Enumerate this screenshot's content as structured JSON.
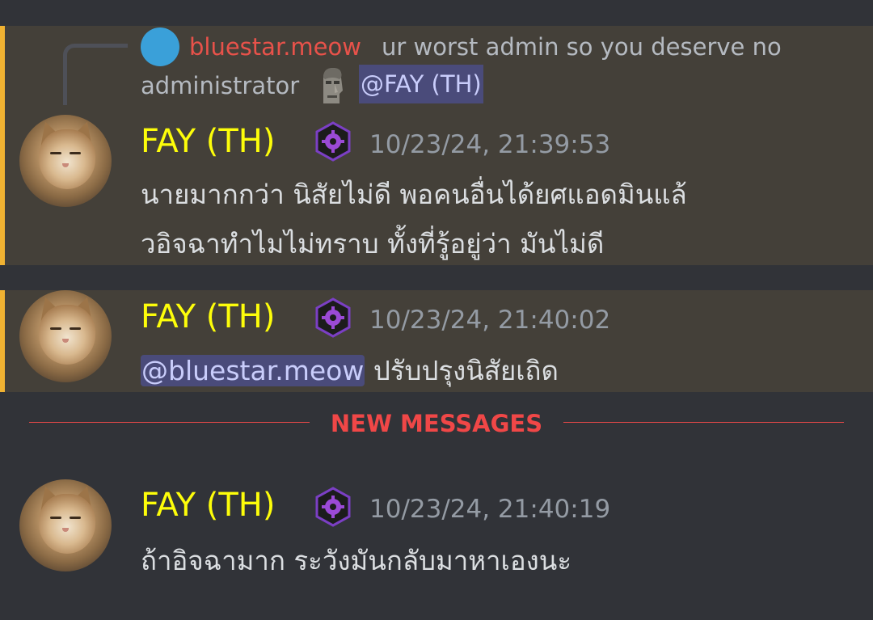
{
  "colors": {
    "background": "#313338",
    "highlight_background": "#444039",
    "mention_bar": "#f0b232",
    "author_name": "#fdfd0a",
    "reply_author": "#e8524a",
    "new_messages": "#f04747",
    "mention_bg": "#4a4b7a",
    "role_icon": "#9b4ad6"
  },
  "reply": {
    "author": "bluestar.meow",
    "text_line1": "ur worst admin so you deserve no",
    "text_line2": "administrator",
    "emoji_icon": "moai-icon",
    "mention": "@FAY (TH)"
  },
  "messages": [
    {
      "author": "FAY (TH)",
      "role_icon": "gear-badge-icon",
      "timestamp": "10/23/24, 21:39:53",
      "lines": [
        "นายมากกว่า นิสัยไม่ดี พอคนอื่นได้ยศแอดมินแล้",
        "วอิจฉาทำไมไม่ทราบ ทั้งที่รู้อยู่ว่า มันไม่ดี"
      ]
    },
    {
      "author": "FAY (TH)",
      "role_icon": "gear-badge-icon",
      "timestamp": "10/23/24, 21:40:02",
      "mention": "@bluestar.meow",
      "text": " ปรับปรุงนิสัยเถิด"
    },
    {
      "author": "FAY (TH)",
      "role_icon": "gear-badge-icon",
      "timestamp": "10/23/24, 21:40:19",
      "text": "ถ้าอิจฉามาก ระวังมันกลับมาหาเองนะ"
    }
  ],
  "divider": {
    "label": "NEW MESSAGES"
  }
}
